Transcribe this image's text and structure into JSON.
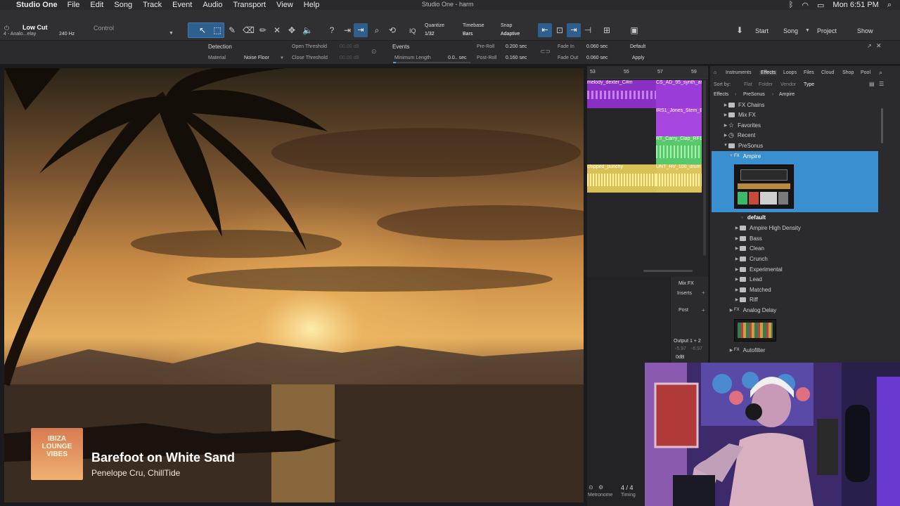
{
  "menubar": {
    "app": "Studio One",
    "items": [
      "File",
      "Edit",
      "Song",
      "Track",
      "Event",
      "Audio",
      "Transport",
      "View",
      "Help"
    ],
    "window_title": "Studio One - harm",
    "clock": "Mon 6:51 PM"
  },
  "toolbar": {
    "preset_name": "Low Cut",
    "track_name": "4 - Analo...elay",
    "freq": "240 Hz",
    "control_label": "Control",
    "quantize_label": "Quantize",
    "quantize_value": "1/32",
    "timebase_label": "Timebase",
    "timebase_value": "Bars",
    "snap_label": "Snap",
    "snap_value": "Adaptive",
    "iq": "IQ",
    "start": "Start",
    "song": "Song",
    "project": "Project",
    "show": "Show"
  },
  "inspector": {
    "detection": "Detection",
    "material": "Material",
    "noise_floor": "Noise Floor",
    "open_threshold": "Open Threshold",
    "close_threshold": "Close Threshold",
    "thr_val_a": "00.00 dB",
    "thr_val_b": "00.00 dB",
    "events": "Events",
    "min_length": "Minimum Length",
    "min_length_val": "0.0.. sec",
    "pre_roll": "Pre-Roll",
    "pre_roll_val": "0.200 sec",
    "post_roll": "Post-Roll",
    "post_roll_val": "0.160 sec",
    "fade_in": "Fade In",
    "fade_in_val": "0.060 sec",
    "fade_out": "Fade Out",
    "fade_out_val": "0.060 sec",
    "default": "Default",
    "apply": "Apply"
  },
  "video": {
    "album_line1": "IBIZA",
    "album_line2": "LOUNGE",
    "album_line3": "VIBES",
    "song_title": "Barefoot on White Sand",
    "artists": "Penelope Cru, ChillTide"
  },
  "arrange": {
    "ruler": [
      "53",
      "55",
      "57",
      "59"
    ],
    "clips": [
      "melody_dexter_C#m",
      "CS_AD_95_synth_ar",
      "IRS1_Jones_Stem_Bi",
      "RT_Carry_Clap_RF1",
      "chipped_punchy",
      "UNT_HV_100_drum"
    ],
    "time_sig": "4 / 4",
    "metronome": "Metronome",
    "timing": "Timing"
  },
  "mixfx": {
    "mix_fx": "Mix FX",
    "inserts": "Inserts",
    "post": "Post",
    "output": "Output 1 + 2",
    "meter_a": "-5.97",
    "meter_b": "-6.97",
    "gain": "0dB"
  },
  "browser": {
    "tabs": [
      "Instruments",
      "Effects",
      "Loops",
      "Files",
      "Cloud",
      "Shop",
      "Pool"
    ],
    "sort_by": "Sort by:",
    "sort_options": [
      "Flat",
      "Folder",
      "Vendor",
      "Type"
    ],
    "crumbs": [
      "Effects",
      "PreSonus",
      "Ampire"
    ],
    "tree": {
      "fx_chains": "FX Chains",
      "mix_fx": "Mix FX",
      "favorites": "Favorites",
      "recent": "Recent",
      "presonus": "PreSonus",
      "ampire": "Ampire",
      "default": "default",
      "presets": [
        "Ampire High Density",
        "Bass",
        "Clean",
        "Crunch",
        "Experimental",
        "Lead",
        "Matched",
        "Riff"
      ],
      "analog_delay": "Analog Delay",
      "autofilter": "Autofilter"
    }
  },
  "colors": {
    "accent": "#4aa3df",
    "selection": "#3a8fd0",
    "clip_purple": "#9b3bd8",
    "clip_green": "#58c86a",
    "clip_yellow": "#dcc45a"
  }
}
